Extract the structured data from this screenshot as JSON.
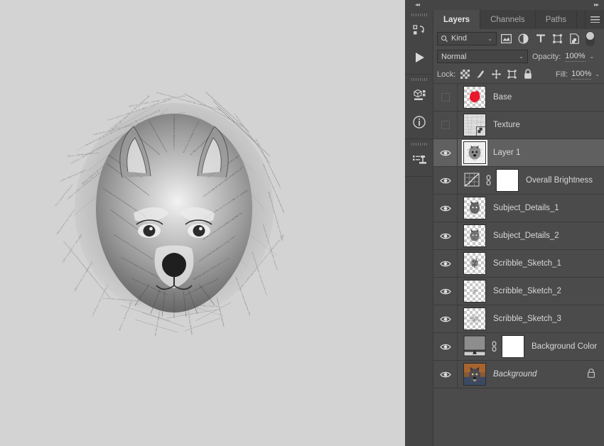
{
  "app": {
    "canvas_bg": "#d3d3d3",
    "panel_bg": "#4b4b4b",
    "dock_bg": "#454545"
  },
  "collapse": {
    "left_arrows": "◂◂",
    "right_arrows": "▸▸"
  },
  "mini_dock": {
    "items": [
      {
        "icon": "history-icon",
        "label": "History"
      },
      {
        "icon": "actions-play-icon",
        "label": "Actions"
      },
      {
        "icon": "3d-panel-icon",
        "label": "3D"
      },
      {
        "icon": "info-icon",
        "label": "Info"
      },
      {
        "icon": "clone-source-icon",
        "label": "Clone Source"
      }
    ]
  },
  "panel": {
    "tabs": [
      {
        "label": "Layers",
        "active": true
      },
      {
        "label": "Channels",
        "active": false
      },
      {
        "label": "Paths",
        "active": false
      }
    ],
    "menu_icon": "hamburger-menu-icon",
    "filter": {
      "search_icon": "search-icon",
      "kind_label": "Kind",
      "caret": "⌄",
      "icons": [
        "pixel-layer-filter-icon",
        "adjustment-layer-filter-icon",
        "type-layer-filter-icon",
        "shape-layer-filter-icon",
        "smart-object-filter-icon"
      ],
      "toggle": "filter-enable-toggle"
    },
    "blend": {
      "mode": "Normal",
      "caret": "⌄",
      "opacity_label": "Opacity:",
      "opacity_value": "100%"
    },
    "lock": {
      "label": "Lock:",
      "icons": [
        "lock-transparent-pixels-icon",
        "lock-image-pixels-icon",
        "lock-position-icon",
        "lock-artboard-nesting-icon",
        "lock-all-icon"
      ],
      "fill_label": "Fill:",
      "fill_value": "100%"
    }
  },
  "layers": [
    {
      "name": "Base",
      "visible": false,
      "selected": false,
      "thumb_type": "red-shape",
      "has_mask": false,
      "smart_object": false,
      "locked": false,
      "italic": false
    },
    {
      "name": "Texture",
      "visible": false,
      "selected": false,
      "thumb_type": "noise-texture",
      "has_mask": false,
      "smart_object": true,
      "locked": false,
      "italic": false
    },
    {
      "name": "Layer 1",
      "visible": true,
      "selected": true,
      "thumb_type": "sketch-gray",
      "has_mask": false,
      "smart_object": false,
      "locked": false,
      "italic": false
    },
    {
      "name": "Overall Brightness",
      "visible": true,
      "selected": false,
      "thumb_type": "curves-adjustment",
      "has_mask": true,
      "smart_object": false,
      "locked": false,
      "italic": false
    },
    {
      "name": "Subject_Details_1",
      "visible": true,
      "selected": false,
      "thumb_type": "sketch-transparent-dense",
      "has_mask": false,
      "smart_object": false,
      "locked": false,
      "italic": false
    },
    {
      "name": "Subject_Details_2",
      "visible": true,
      "selected": false,
      "thumb_type": "sketch-transparent-dense",
      "has_mask": false,
      "smart_object": false,
      "locked": false,
      "italic": false
    },
    {
      "name": "Scribble_Sketch_1",
      "visible": true,
      "selected": false,
      "thumb_type": "sketch-transparent-medium",
      "has_mask": false,
      "smart_object": false,
      "locked": false,
      "italic": false
    },
    {
      "name": "Scribble_Sketch_2",
      "visible": true,
      "selected": false,
      "thumb_type": "sketch-transparent-light",
      "has_mask": false,
      "smart_object": false,
      "locked": false,
      "italic": false
    },
    {
      "name": "Scribble_Sketch_3",
      "visible": true,
      "selected": false,
      "thumb_type": "sketch-transparent-medium",
      "has_mask": false,
      "smart_object": false,
      "locked": false,
      "italic": false
    },
    {
      "name": "Background Color",
      "visible": true,
      "selected": false,
      "thumb_type": "gradient-adjustment",
      "has_mask": true,
      "smart_object": false,
      "locked": false,
      "italic": false
    },
    {
      "name": "Background",
      "visible": true,
      "selected": false,
      "thumb_type": "photo-wolf",
      "has_mask": false,
      "smart_object": false,
      "locked": true,
      "italic": true
    }
  ],
  "artwork": {
    "title": "wolf-pencil-sketch",
    "description": "Graphite scribble sketch portrait of a wolf head"
  }
}
